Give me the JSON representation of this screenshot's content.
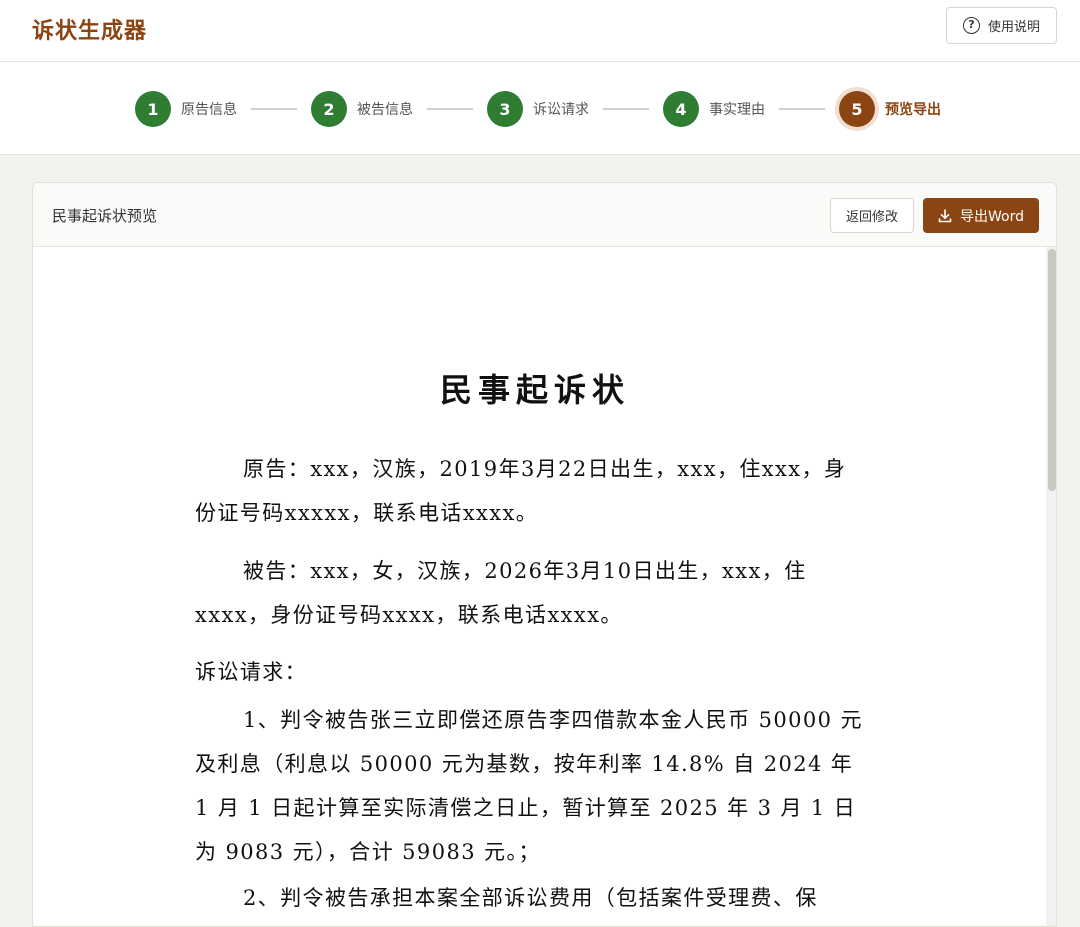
{
  "app": {
    "title": "诉状生成器",
    "help_label": "使用说明",
    "help_icon": "question-circle-icon"
  },
  "steps": [
    {
      "num": "1",
      "label": "原告信息",
      "status": "done"
    },
    {
      "num": "2",
      "label": "被告信息",
      "status": "done"
    },
    {
      "num": "3",
      "label": "诉讼请求",
      "status": "done"
    },
    {
      "num": "4",
      "label": "事实理由",
      "status": "done"
    },
    {
      "num": "5",
      "label": "预览导出",
      "status": "active"
    }
  ],
  "panel": {
    "title": "民事起诉状预览",
    "back_label": "返回修改",
    "export_label": "导出Word",
    "export_icon": "download-icon"
  },
  "document": {
    "title": "民事起诉状",
    "plaintiff": "原告：xxx，汉族，2019年3月22日出生，xxx，住xxx，身份证号码xxxxx，联系电话xxxx。",
    "defendant": "被告：xxx，女，汉族，2026年3月10日出生，xxx，住xxxx，身份证号码xxxx，联系电话xxxx。",
    "claims_heading": "诉讼请求：",
    "claim_1": "1、判令被告张三立即偿还原告李四借款本金人民币 50000 元及利息（利息以 50000 元为基数，按年利率 14.8% 自 2024 年 1 月 1 日起计算至实际清偿之日止，暂计算至 2025 年 3 月 1 日为 9083 元），合计 59083 元。；",
    "claim_2": "2、判令被告承担本案全部诉讼费用（包括案件受理费、保"
  },
  "colors": {
    "brand": "#8b4513",
    "step_done": "#2e7d32",
    "background": "#f3f2ee"
  }
}
